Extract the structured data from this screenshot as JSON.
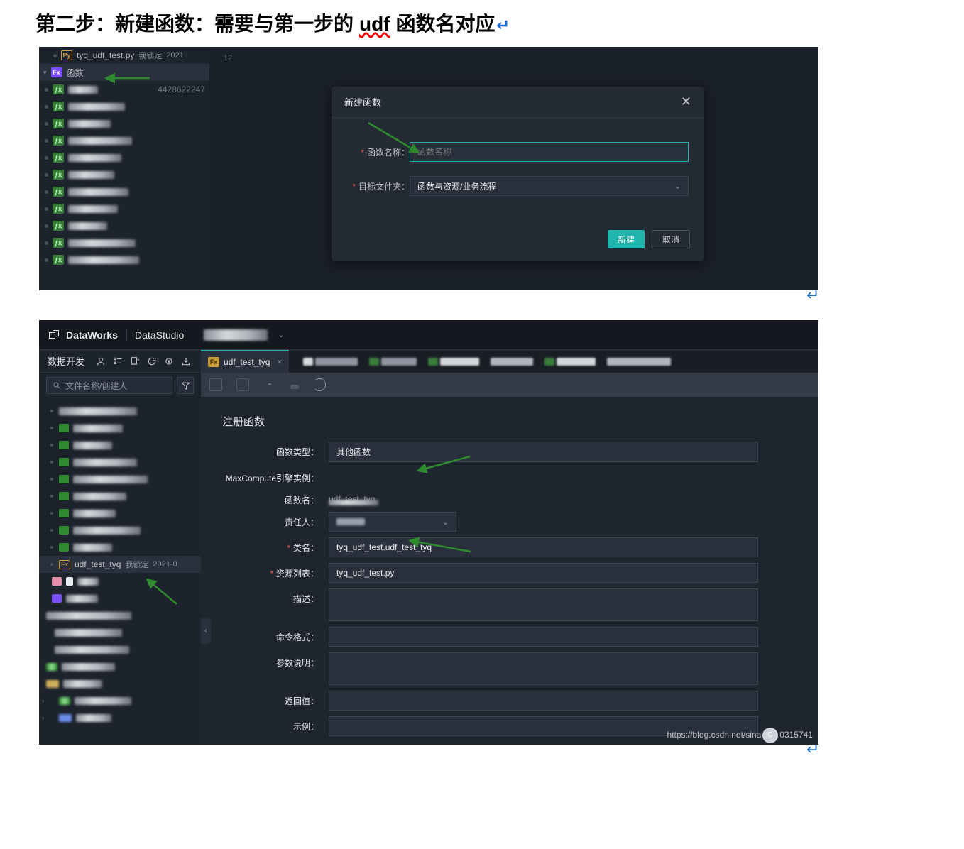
{
  "heading": {
    "part1": "第二步：新建函数：需要与第一步的",
    "udf": "udf",
    "part2": "函数名对应"
  },
  "panel1": {
    "tree_py": {
      "name": "tyq_udf_test.py",
      "status": "我锁定",
      "date": "2021"
    },
    "tree_fx_label": "函数",
    "tree_id_suffix": "4428622247",
    "line_num": "12",
    "modal": {
      "title": "新建函数",
      "name_label": "函数名称：",
      "name_placeholder": "函数名称",
      "folder_label": "目标文件夹：",
      "folder_value": "函数与资源/业务流程",
      "create_btn": "新建",
      "cancel_btn": "取消"
    }
  },
  "panel2": {
    "brand": "DataWorks",
    "studio": "DataStudio",
    "left": {
      "tab_title": "数据开发",
      "search_placeholder": "文件名称/创建人",
      "tree_fx": {
        "name": "udf_test_tyq",
        "status": "我锁定",
        "date": "2021-0"
      }
    },
    "tab_active": "udf_test_tyq",
    "form": {
      "section": "注册函数",
      "type_label": "函数类型：",
      "type_value": "其他函数",
      "engine_label": "MaxCompute引擎实例：",
      "fname_label": "函数名：",
      "fname_value": "udf_test_tyq",
      "owner_label": "责任人：",
      "class_label": "类名：",
      "class_value": "tyq_udf_test.udf_test_tyq",
      "resource_label": "资源列表：",
      "resource_value": "tyq_udf_test.py",
      "desc_label": "描述：",
      "cmd_label": "命令格式：",
      "param_label": "参数说明：",
      "return_label": "返回值：",
      "example_label": "示例："
    },
    "watermark": {
      "prefix": "https://blog.csdn.net/sina",
      "suffix": "0315741"
    }
  }
}
